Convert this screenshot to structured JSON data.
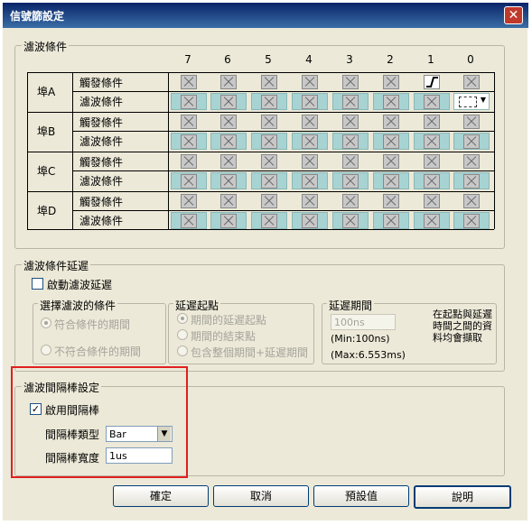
{
  "window": {
    "title": "信號篩設定",
    "close_glyph": "✕"
  },
  "filter_condition": {
    "legend": "濾波條件",
    "bits": [
      "7",
      "6",
      "5",
      "4",
      "3",
      "2",
      "1",
      "0"
    ],
    "ports": [
      {
        "name": "埠A",
        "trigger_label": "觸發條件",
        "filter_label": "濾波條件"
      },
      {
        "name": "埠B",
        "trigger_label": "觸發條件",
        "filter_label": "濾波條件"
      },
      {
        "name": "埠C",
        "trigger_label": "觸發條件",
        "filter_label": "濾波條件"
      },
      {
        "name": "埠D",
        "trigger_label": "觸發條件",
        "filter_label": "濾波條件"
      }
    ]
  },
  "filter_delay": {
    "legend": "濾波條件延遲",
    "enable_label": "啟動濾波延遲",
    "select_group": {
      "legend": "選擇濾波的條件",
      "options": [
        "符合條件的期間",
        "不符合條件的期間"
      ]
    },
    "start_group": {
      "legend": "延遲起點",
      "options": [
        "期間的延遲起點",
        "期間的結束點",
        "包含整個期間+延遲期間"
      ]
    },
    "period_group": {
      "legend": "延遲期間",
      "value": "100ns",
      "min": "(Min:100ns)",
      "max": "(Max:6.553ms)",
      "note": "在起點與延遲時間之間的資料均會擷取"
    }
  },
  "gap_bar": {
    "legend": "濾波間隔棒設定",
    "enable_label": "啟用間隔棒",
    "type_label": "間隔棒類型",
    "type_value": "Bar",
    "width_label": "間隔棒寬度",
    "width_value": "1us"
  },
  "buttons": {
    "ok": "確定",
    "cancel": "取消",
    "default": "預設值",
    "help": "說明"
  },
  "colors": {
    "highlight": "#e02020",
    "filter_cell": "#a7d3d3"
  }
}
